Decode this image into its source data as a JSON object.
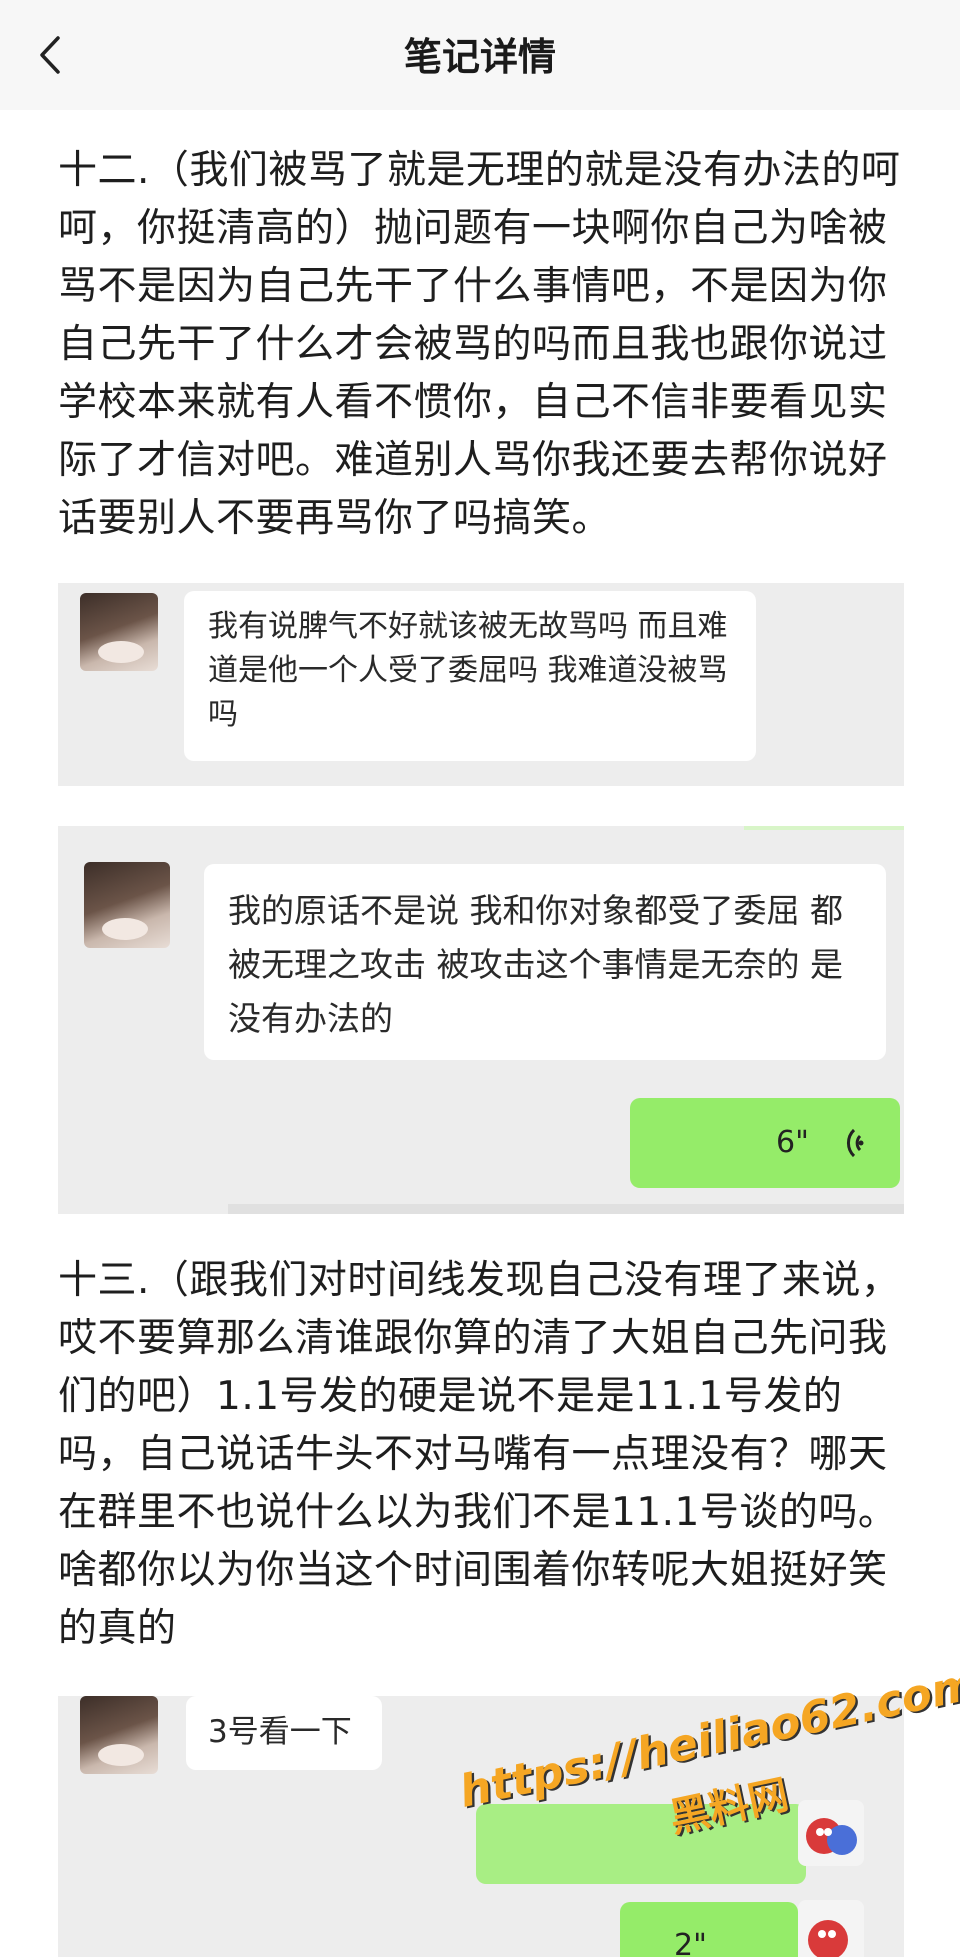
{
  "header": {
    "title": "笔记详情"
  },
  "content": {
    "paragraph_12": "十二.（我们被骂了就是无理的就是没有办法的呵呵，你挺清高的）抛问题有一块啊你自己为啥被骂不是因为自己先干了什么事情吧，不是因为你自己先干了什么才会被骂的吗而且我也跟你说过学校本来就有人看不惯你，自己不信非要看见实际了才信对吧。难道别人骂你我还要去帮你说好话要别人不要再骂你了吗搞笑。",
    "paragraph_13": "十三.（跟我们对时间线发现自己没有理了来说，哎不要算那么清谁跟你算的清了大姐自己先问我们的吧）1.1号发的硬是说不是是11.1号发的吗，自己说话牛头不对马嘴有一点理没有？哪天在群里不也说什么以为我们不是11.1号谈的吗。啥都你以为你当这个时间围着你转呢大姐挺好笑的真的"
  },
  "screenshot_1": {
    "message": "我有说脾气不好就该被无故骂吗 而且难道是他一个人受了委屈吗 我难道没被骂吗"
  },
  "screenshot_2": {
    "message": "我的原话不是说 我和你对象都受了委屈 都被无理之攻击 被攻击这个事情是无奈的 是没有办法的",
    "voice_duration": "6\""
  },
  "screenshot_3": {
    "message": "3号看一下",
    "voice_duration": "2\""
  },
  "watermark": {
    "url": "https://heiliao62.com",
    "name": "黑料网"
  },
  "colors": {
    "voice_bubble": "#95ec69",
    "chat_background": "#ededed",
    "watermark": "#f5a623"
  }
}
